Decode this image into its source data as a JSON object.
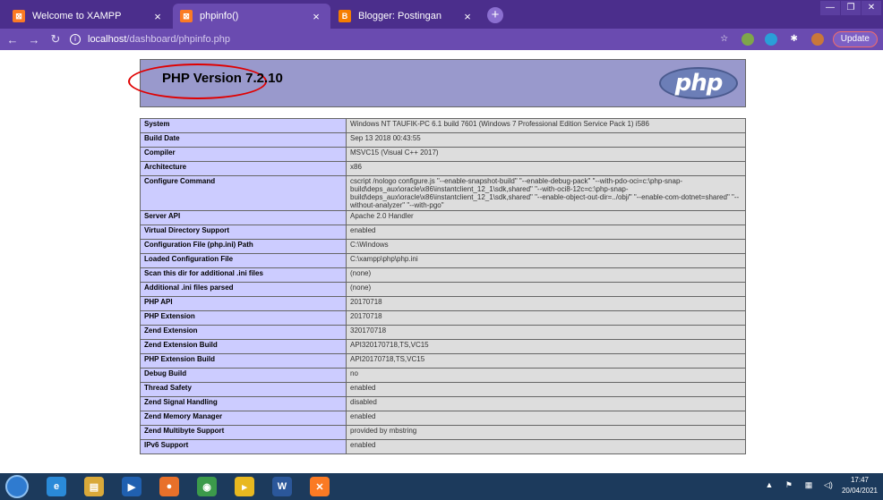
{
  "tabs": [
    {
      "title": "Welcome to XAMPP",
      "favicon": "xampp-icon",
      "color": "#fb7a24"
    },
    {
      "title": "phpinfo()",
      "favicon": "xampp-icon",
      "color": "#fb7a24"
    },
    {
      "title": "Blogger: Postingan",
      "favicon": "blogger-icon",
      "color": "#f57d00"
    }
  ],
  "address": {
    "host": "localhost",
    "path": "/dashboard/phpinfo.php"
  },
  "toolbar": {
    "update_label": "Update"
  },
  "php": {
    "title": "PHP Version 7.2.10",
    "logo_text": "php",
    "rows": [
      {
        "label": "System",
        "value": "Windows NT TAUFIK-PC 6.1 build 7601 (Windows 7 Professional Edition Service Pack 1) i586"
      },
      {
        "label": "Build Date",
        "value": "Sep 13 2018 00:43:55"
      },
      {
        "label": "Compiler",
        "value": "MSVC15 (Visual C++ 2017)"
      },
      {
        "label": "Architecture",
        "value": "x86"
      },
      {
        "label": "Configure Command",
        "value": "cscript /nologo configure.js \"--enable-snapshot-build\" \"--enable-debug-pack\" \"--with-pdo-oci=c:\\php-snap-build\\deps_aux\\oracle\\x86\\instantclient_12_1\\sdk,shared\" \"--with-oci8-12c=c:\\php-snap-build\\deps_aux\\oracle\\x86\\instantclient_12_1\\sdk,shared\" \"--enable-object-out-dir=../obj/\" \"--enable-com-dotnet=shared\" \"--without-analyzer\" \"--with-pgo\""
      },
      {
        "label": "Server API",
        "value": "Apache 2.0 Handler"
      },
      {
        "label": "Virtual Directory Support",
        "value": "enabled"
      },
      {
        "label": "Configuration File (php.ini) Path",
        "value": "C:\\Windows"
      },
      {
        "label": "Loaded Configuration File",
        "value": "C:\\xampp\\php\\php.ini"
      },
      {
        "label": "Scan this dir for additional .ini files",
        "value": "(none)"
      },
      {
        "label": "Additional .ini files parsed",
        "value": "(none)"
      },
      {
        "label": "PHP API",
        "value": "20170718"
      },
      {
        "label": "PHP Extension",
        "value": "20170718"
      },
      {
        "label": "Zend Extension",
        "value": "320170718"
      },
      {
        "label": "Zend Extension Build",
        "value": "API320170718,TS,VC15"
      },
      {
        "label": "PHP Extension Build",
        "value": "API20170718,TS,VC15"
      },
      {
        "label": "Debug Build",
        "value": "no"
      },
      {
        "label": "Thread Safety",
        "value": "enabled"
      },
      {
        "label": "Zend Signal Handling",
        "value": "disabled"
      },
      {
        "label": "Zend Memory Manager",
        "value": "enabled"
      },
      {
        "label": "Zend Multibyte Support",
        "value": "provided by mbstring"
      },
      {
        "label": "IPv6 Support",
        "value": "enabled"
      }
    ]
  },
  "taskbar": {
    "apps": [
      {
        "name": "ie-icon",
        "color": "#2a8ad8",
        "glyph": "e"
      },
      {
        "name": "explorer-icon",
        "color": "#d9a93a",
        "glyph": "▤"
      },
      {
        "name": "media-player-icon",
        "color": "#2060b0",
        "glyph": "▶"
      },
      {
        "name": "firefox-icon",
        "color": "#e8702a",
        "glyph": "●"
      },
      {
        "name": "chrome-icon",
        "color": "#3c9a4b",
        "glyph": "◉"
      },
      {
        "name": "potplayer-icon",
        "color": "#e8b820",
        "glyph": "▸"
      },
      {
        "name": "word-icon",
        "color": "#2b579a",
        "glyph": "W"
      },
      {
        "name": "xampp-taskbar-icon",
        "color": "#fb7a24",
        "glyph": "✕"
      }
    ],
    "time": "17:47",
    "date": "20/04/2021"
  }
}
